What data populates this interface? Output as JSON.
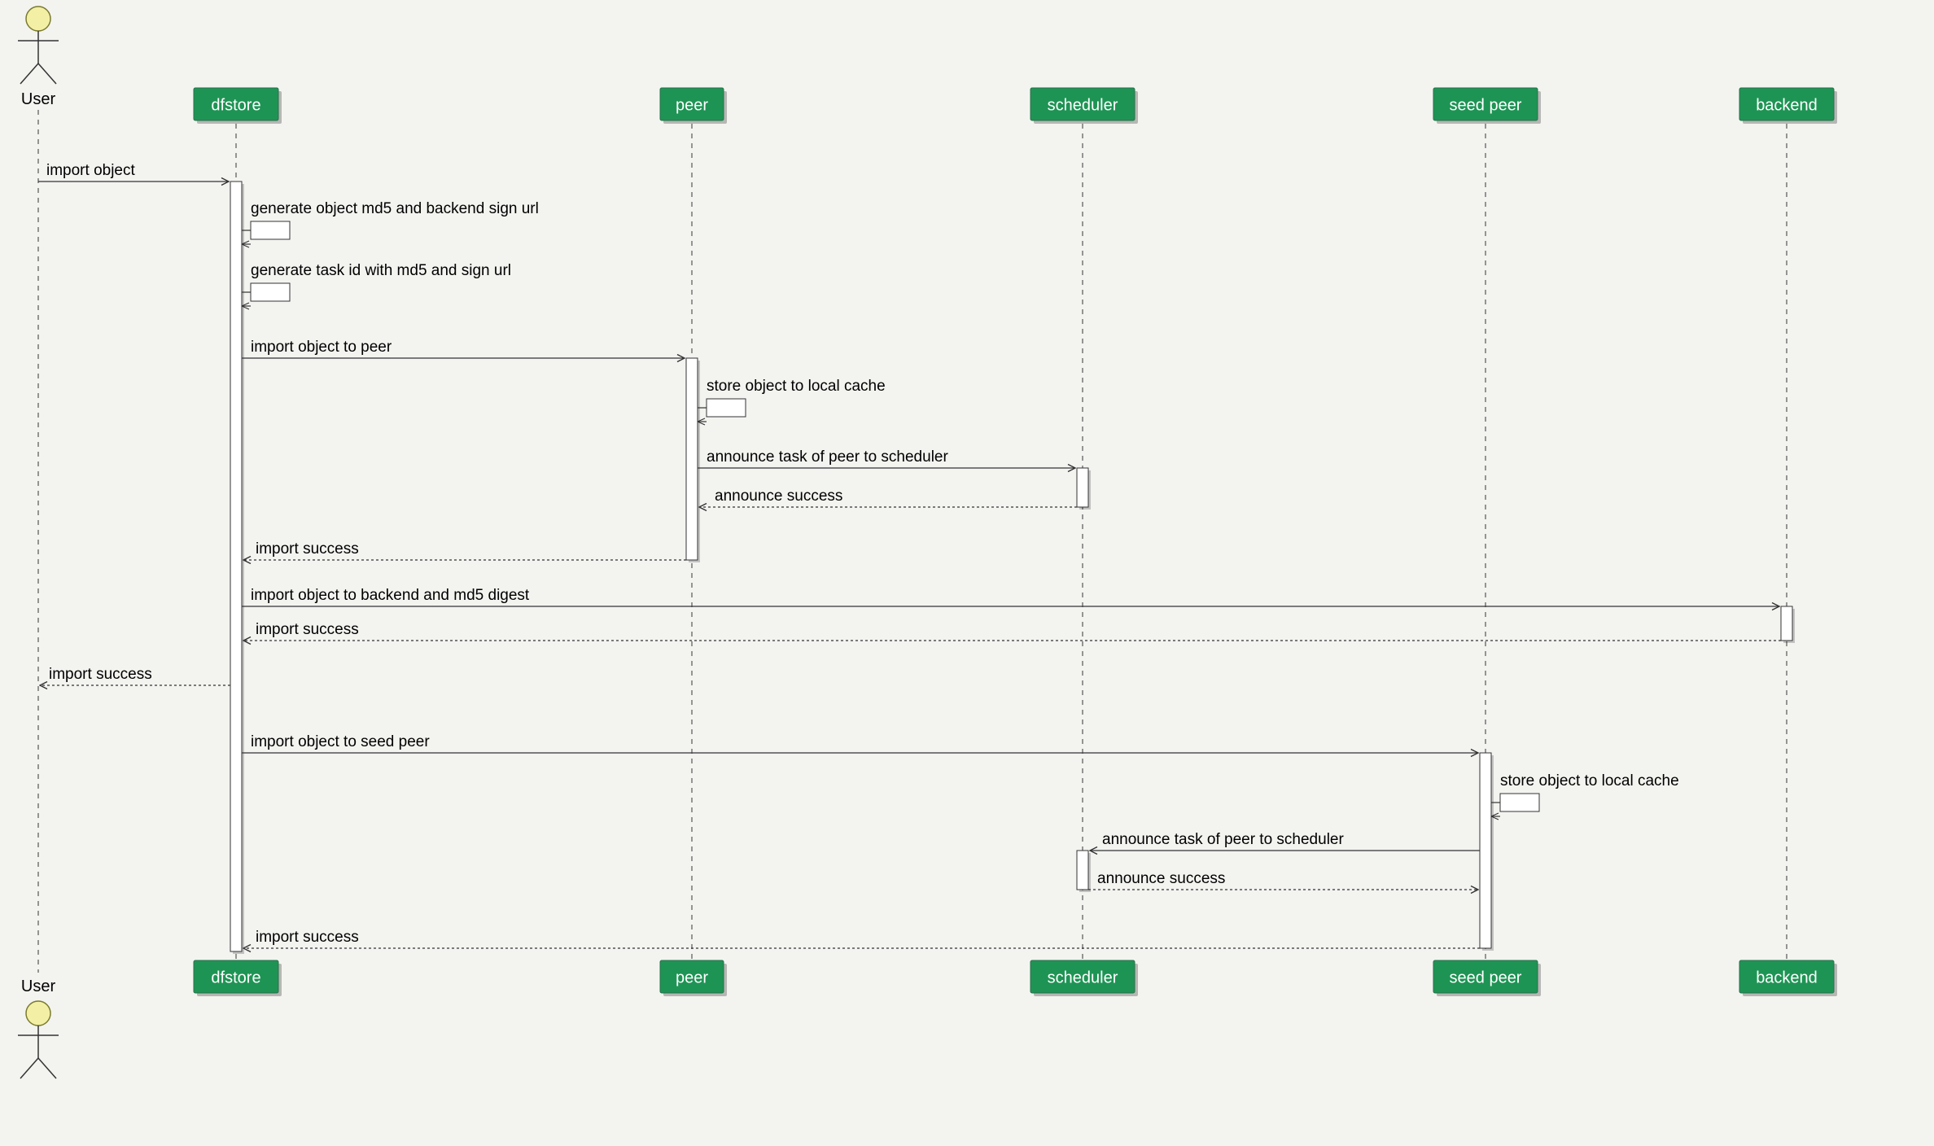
{
  "diagram": {
    "type": "sequence",
    "actor": {
      "name": "User"
    },
    "participants": [
      {
        "id": "dfstore",
        "label": "dfstore"
      },
      {
        "id": "peer",
        "label": "peer"
      },
      {
        "id": "scheduler",
        "label": "scheduler"
      },
      {
        "id": "seedpeer",
        "label": "seed peer"
      },
      {
        "id": "backend",
        "label": "backend"
      }
    ],
    "messages": {
      "m1": "import object",
      "m2": "generate object md5 and backend sign url",
      "m3": "generate task id with md5 and sign url",
      "m4": "import object to peer",
      "m5": "store object to local cache",
      "m6": "announce task of peer to scheduler",
      "m7": "announce success",
      "m8": "import success",
      "m9": "import object to backend and md5 digest",
      "m10": "import success",
      "m11": "import success",
      "m12": "import object to seed peer",
      "m13": "store object to local cache",
      "m14": "announce task of peer to scheduler",
      "m15": "announce success",
      "m16": "import success"
    },
    "colors": {
      "participant": "#1e9454",
      "background": "#f3f4f0"
    }
  }
}
